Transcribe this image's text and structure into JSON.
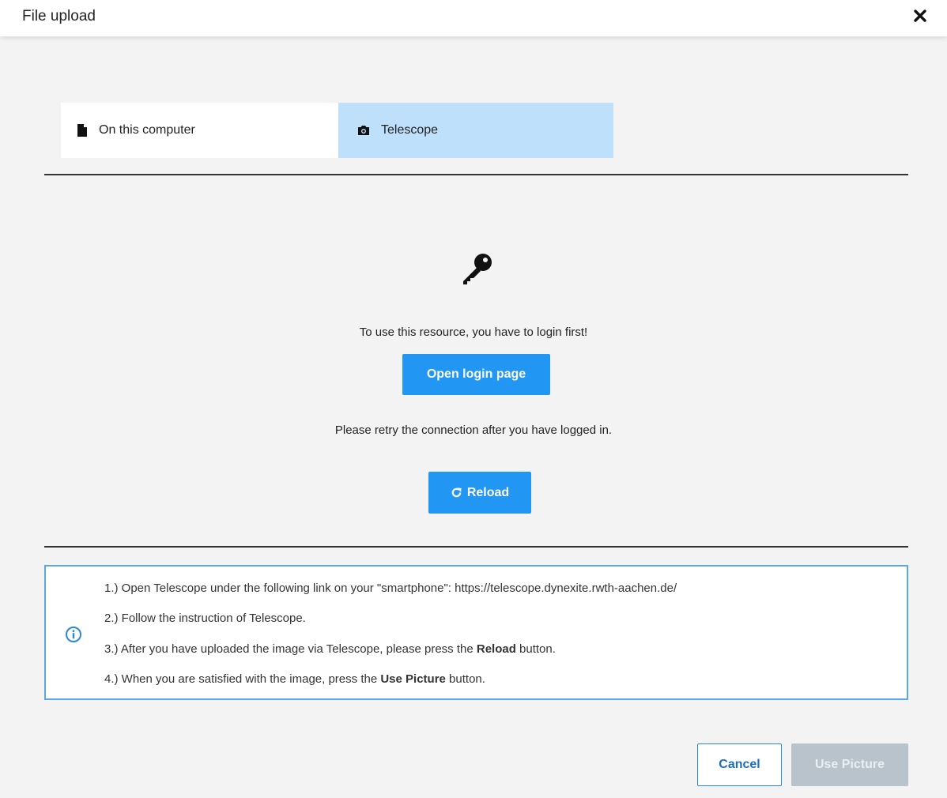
{
  "dialog": {
    "title": "File upload",
    "close_icon": "close-icon"
  },
  "tabs": [
    {
      "label": "On this computer",
      "icon": "file-icon",
      "active": false
    },
    {
      "label": "Telescope",
      "icon": "camera-icon",
      "active": true
    }
  ],
  "content": {
    "lock_icon": "key-icon",
    "login_message": "To use this resource, you have to login first!",
    "open_login_label": "Open login page",
    "retry_message": "Please retry the connection after you have logged in.",
    "reload_label": "Reload",
    "reload_icon": "refresh-icon"
  },
  "info": {
    "icon": "info-icon",
    "steps": [
      {
        "text": "1.) Open Telescope under the following link on your \"smartphone\": https://telescope.dynexite.rwth-aachen.de/"
      },
      {
        "text": "2.) Follow the instruction of Telescope."
      },
      {
        "before": "3.) After you have uploaded the image via Telescope, please press the ",
        "bold": "Reload",
        "after": " button."
      },
      {
        "before": "4.) When you are satisfied with the image, press the ",
        "bold": "Use Picture",
        "after": " button."
      }
    ]
  },
  "footer": {
    "cancel_label": "Cancel",
    "use_picture_label": "Use Picture",
    "use_picture_disabled": true
  },
  "colors": {
    "accent": "#2196f3",
    "active_tab": "#bfe0fb",
    "info_border": "#5aa7e6",
    "disabled_button": "#b8c3cc"
  }
}
